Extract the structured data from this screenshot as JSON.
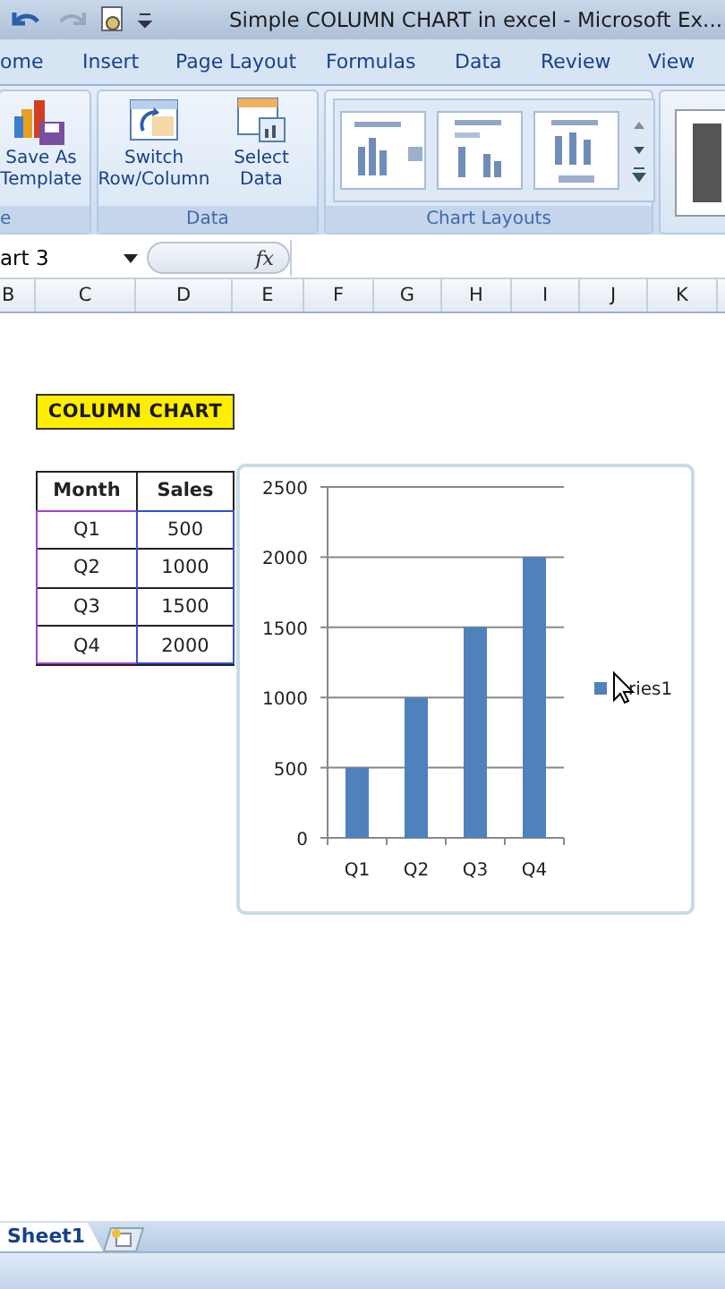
{
  "window": {
    "title": "Simple COLUMN CHART in excel - Microsoft Ex..."
  },
  "tabs": [
    {
      "label": "ome",
      "selected": false
    },
    {
      "label": "Insert",
      "selected": false
    },
    {
      "label": "Page Layout",
      "selected": false
    },
    {
      "label": "Formulas",
      "selected": false
    },
    {
      "label": "Data",
      "selected": false
    },
    {
      "label": "Review",
      "selected": false
    },
    {
      "label": "View",
      "selected": false
    }
  ],
  "ribbon": {
    "groups": [
      {
        "kind": "buttons",
        "label": "e",
        "buttons": [
          {
            "kind": "template",
            "label": "Save As Template"
          }
        ]
      },
      {
        "kind": "buttons",
        "label": "Data",
        "buttons": [
          {
            "kind": "switch",
            "label": "Switch Row/Column"
          },
          {
            "kind": "select",
            "label": "Select Data"
          }
        ]
      },
      {
        "kind": "gallery",
        "label": "Chart Layouts",
        "items": [
          {
            "kind": "legend-right"
          },
          {
            "kind": "title-top"
          },
          {
            "kind": "legend-bottom"
          }
        ]
      },
      {
        "kind": "partial"
      }
    ]
  },
  "formula_bar": {
    "name_box": "art 3",
    "fx": "fx"
  },
  "columns": [
    "B",
    "C",
    "D",
    "E",
    "F",
    "G",
    "H",
    "I",
    "J",
    "K"
  ],
  "sheet": {
    "title_label": "COLUMN CHART",
    "table": {
      "columns": [
        "Month",
        "Sales"
      ],
      "rows": [
        [
          "Q1",
          "500"
        ],
        [
          "Q2",
          "1000"
        ],
        [
          "Q3",
          "1500"
        ],
        [
          "Q4",
          "2000"
        ]
      ]
    },
    "chart": {
      "chart_data": {
        "type": "bar",
        "grid": true,
        "categories": [
          "Q1",
          "Q2",
          "Q3",
          "Q4"
        ],
        "series": [
          {
            "name": "ries1",
            "color": "#4f81bd",
            "values": [
              500,
              1000,
              1500,
              2000
            ]
          }
        ],
        "ylim": [
          0,
          2500
        ],
        "yticks": [
          0,
          500,
          1000,
          1500,
          2000,
          2500
        ]
      }
    }
  },
  "sheet_tabs": [
    {
      "label": "Sheet1",
      "selected": true
    }
  ]
}
